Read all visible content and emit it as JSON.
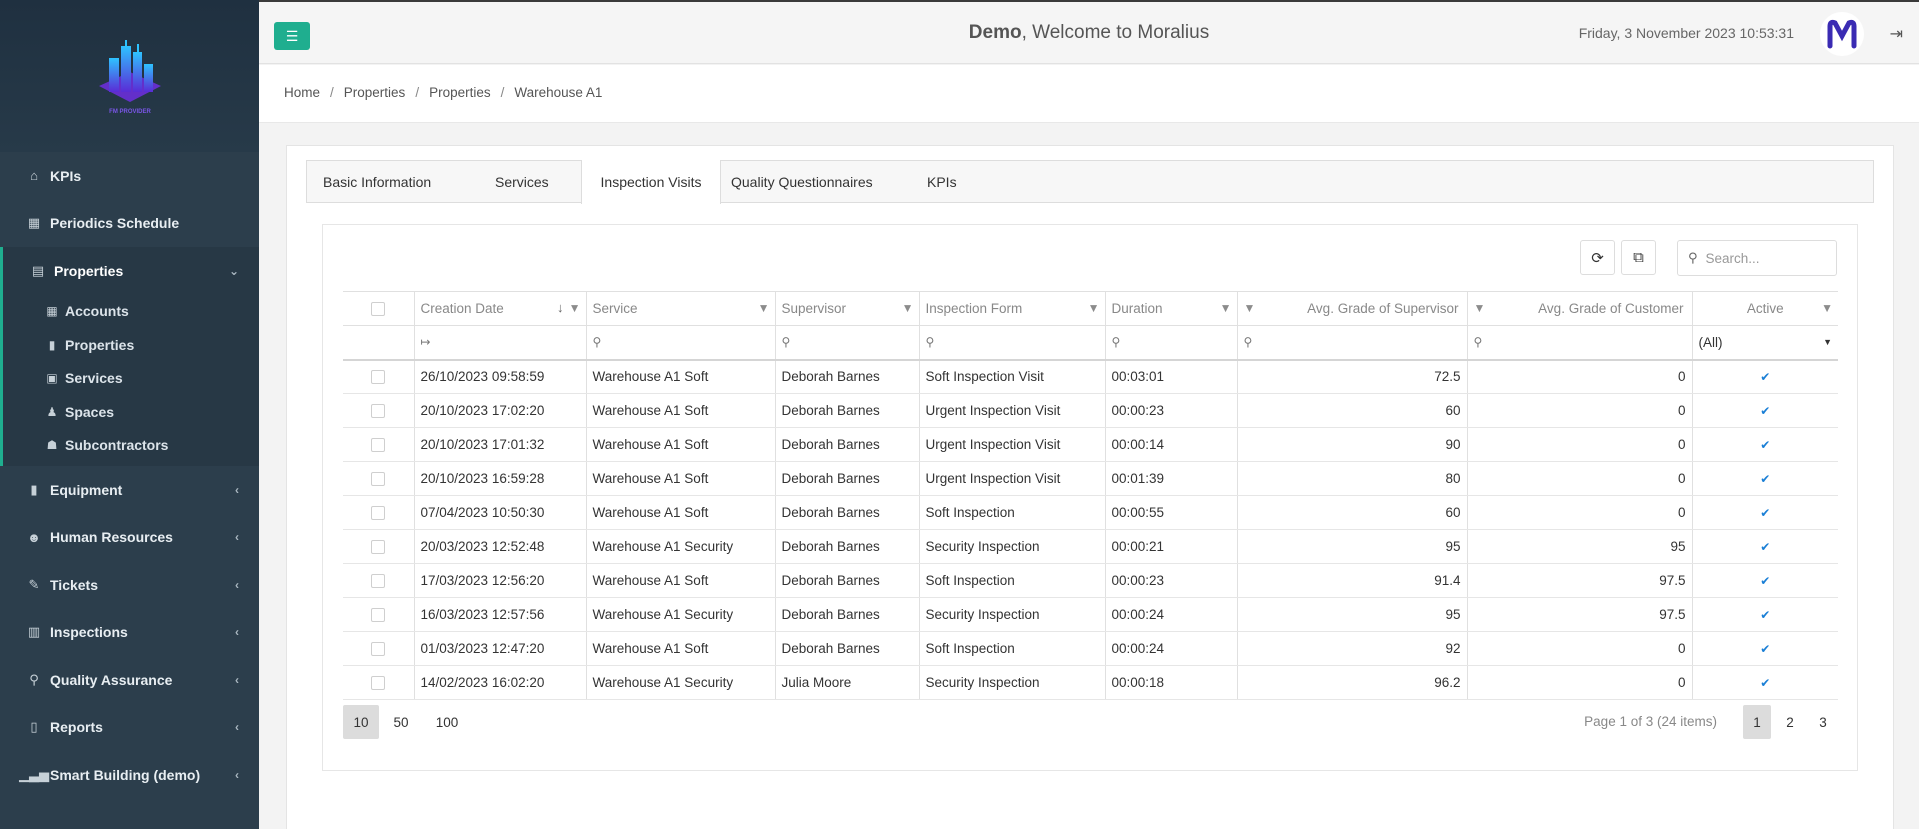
{
  "sidebar": {
    "logo_text": "FM PROVIDER",
    "items": [
      {
        "label": "KPIs",
        "icon": "home-icon"
      },
      {
        "label": "Periodics Schedule",
        "icon": "calendar-icon"
      },
      {
        "label": "Properties",
        "icon": "building-icon",
        "active": true
      },
      {
        "label": "Equipment",
        "icon": "equipment-icon"
      },
      {
        "label": "Human Resources",
        "icon": "users-icon"
      },
      {
        "label": "Tickets",
        "icon": "tickets-icon"
      },
      {
        "label": "Inspections",
        "icon": "map-icon"
      },
      {
        "label": "Quality Assurance",
        "icon": "quality-icon"
      },
      {
        "label": "Reports",
        "icon": "book-icon"
      },
      {
        "label": "Smart Building (demo)",
        "icon": "chart-icon"
      }
    ],
    "sub_items": [
      {
        "label": "Accounts",
        "icon": "accounts-icon"
      },
      {
        "label": "Properties",
        "icon": "properties-icon"
      },
      {
        "label": "Services",
        "icon": "services-icon"
      },
      {
        "label": "Spaces",
        "icon": "spaces-icon"
      },
      {
        "label": "Subcontractors",
        "icon": "subcontractors-icon"
      }
    ]
  },
  "header": {
    "user": "Demo",
    "welcome": ", Welcome to Moralius",
    "datetime": "Friday, 3 November 2023 10:53:31",
    "accent": "#1fae8f"
  },
  "breadcrumb": [
    "Home",
    "Properties",
    "Properties",
    "Warehouse A1"
  ],
  "tabs": [
    "Basic Information",
    "Services",
    "Inspection Visits",
    "Quality Questionnaires",
    "KPIs"
  ],
  "active_tab": "Inspection Visits",
  "grid": {
    "search_placeholder": "Search...",
    "columns": [
      "Creation Date",
      "Service",
      "Supervisor",
      "Inspection Form",
      "Duration",
      "Avg. Grade of Supervisor",
      "Avg. Grade of Customer",
      "Active"
    ],
    "active_filter_value": "(All)",
    "rows": [
      {
        "date": "26/10/2023 09:58:59",
        "service": "Warehouse A1 Soft",
        "supervisor": "Deborah Barnes",
        "form": "Soft Inspection Visit",
        "duration": "00:03:01",
        "sup_grade": "72.5",
        "cust_grade": "0"
      },
      {
        "date": "20/10/2023 17:02:20",
        "service": "Warehouse A1 Soft",
        "supervisor": "Deborah Barnes",
        "form": "Urgent Inspection Visit",
        "duration": "00:00:23",
        "sup_grade": "60",
        "cust_grade": "0"
      },
      {
        "date": "20/10/2023 17:01:32",
        "service": "Warehouse A1 Soft",
        "supervisor": "Deborah Barnes",
        "form": "Urgent Inspection Visit",
        "duration": "00:00:14",
        "sup_grade": "90",
        "cust_grade": "0"
      },
      {
        "date": "20/10/2023 16:59:28",
        "service": "Warehouse A1 Soft",
        "supervisor": "Deborah Barnes",
        "form": "Urgent Inspection Visit",
        "duration": "00:01:39",
        "sup_grade": "80",
        "cust_grade": "0"
      },
      {
        "date": "07/04/2023 10:50:30",
        "service": "Warehouse A1 Soft",
        "supervisor": "Deborah Barnes",
        "form": "Soft Inspection",
        "duration": "00:00:55",
        "sup_grade": "60",
        "cust_grade": "0"
      },
      {
        "date": "20/03/2023 12:52:48",
        "service": "Warehouse A1 Security",
        "supervisor": "Deborah Barnes",
        "form": "Security Inspection",
        "duration": "00:00:21",
        "sup_grade": "95",
        "cust_grade": "95"
      },
      {
        "date": "17/03/2023 12:56:20",
        "service": "Warehouse A1 Soft",
        "supervisor": "Deborah Barnes",
        "form": "Soft Inspection",
        "duration": "00:00:23",
        "sup_grade": "91.4",
        "cust_grade": "97.5"
      },
      {
        "date": "16/03/2023 12:57:56",
        "service": "Warehouse A1 Security",
        "supervisor": "Deborah Barnes",
        "form": "Security Inspection",
        "duration": "00:00:24",
        "sup_grade": "95",
        "cust_grade": "97.5"
      },
      {
        "date": "01/03/2023 12:47:20",
        "service": "Warehouse A1 Soft",
        "supervisor": "Deborah Barnes",
        "form": "Soft Inspection",
        "duration": "00:00:24",
        "sup_grade": "92",
        "cust_grade": "0"
      },
      {
        "date": "14/02/2023 16:02:20",
        "service": "Warehouse A1 Security",
        "supervisor": "Julia Moore",
        "form": "Security Inspection",
        "duration": "00:00:18",
        "sup_grade": "96.2",
        "cust_grade": "0"
      }
    ]
  },
  "pager": {
    "sizes": [
      "10",
      "50",
      "100"
    ],
    "selected_size": "10",
    "info": "Page 1 of 3 (24 items)",
    "pages": [
      "1",
      "2",
      "3"
    ],
    "current_page": "1"
  }
}
